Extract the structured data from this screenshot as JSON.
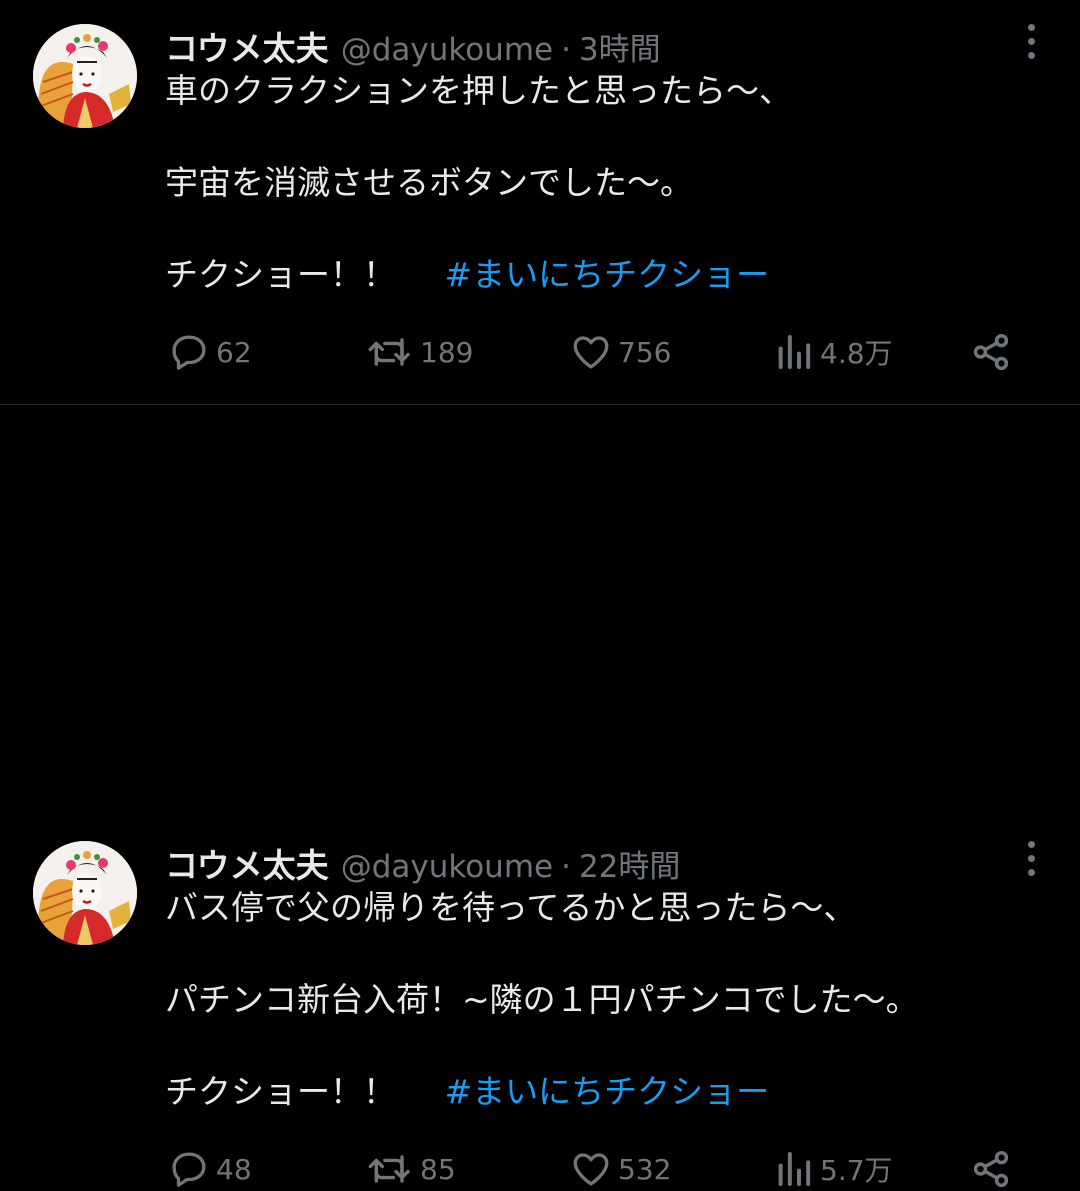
{
  "tweets": [
    {
      "name": "コウメ太夫",
      "handle": "@dayukoume",
      "time": "3時間",
      "line1": "車のクラクションを押したと思ったら〜、",
      "line2": "宇宙を消滅させるボタンでした〜。",
      "line3": "チクショー！！",
      "hashtag": "#まいにちチクショー",
      "replies": "62",
      "retweets": "189",
      "likes": "756",
      "views": "4.8万"
    },
    {
      "name": "コウメ太夫",
      "handle": "@dayukoume",
      "time": "22時間",
      "line1": "バス停で父の帰りを待ってるかと思ったら〜、",
      "line2": "パチンコ新台入荷！~隣の１円パチンコでした〜。",
      "line3": "チクショー！！",
      "hashtag": "#まいにちチクショー",
      "replies": "48",
      "retweets": "85",
      "likes": "532",
      "views": "5.7万"
    }
  ],
  "icons": {
    "more": "more-vertical-icon",
    "reply": "reply-icon",
    "retweet": "retweet-icon",
    "like": "heart-icon",
    "views": "views-chart-icon",
    "share": "share-icon"
  },
  "colors": {
    "background": "#000000",
    "text": "#e7e9ea",
    "muted": "#71767b",
    "hashtag": "#1d9bf0",
    "divider": "#2f3336"
  }
}
